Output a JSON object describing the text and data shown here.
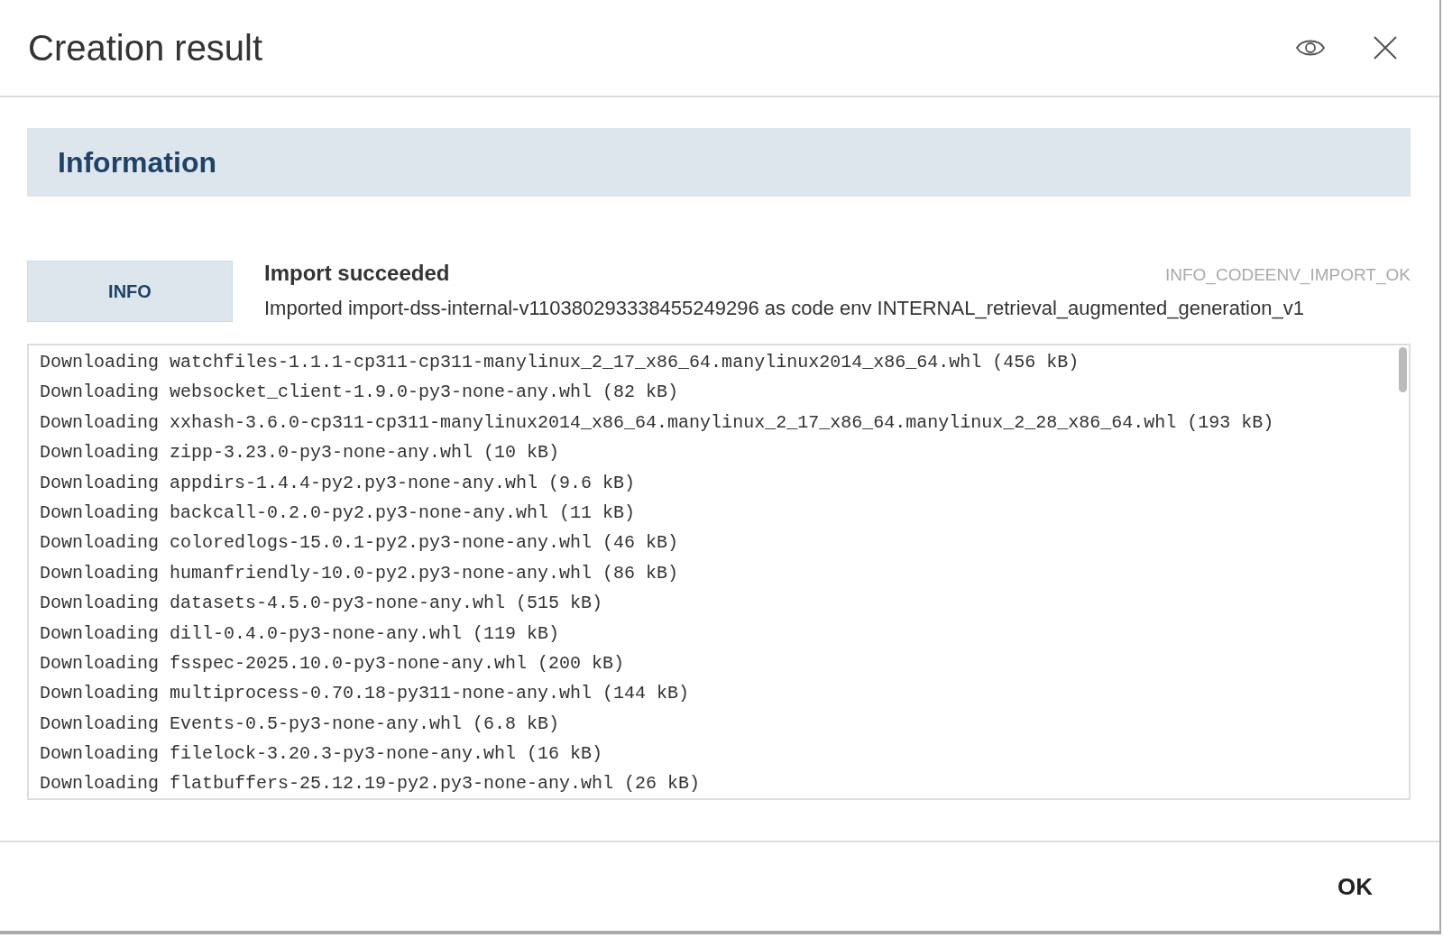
{
  "dialog": {
    "title": "Creation result"
  },
  "section": {
    "title": "Information"
  },
  "message": {
    "level": "INFO",
    "title": "Import succeeded",
    "code": "INFO_CODEENV_IMPORT_OK",
    "text": "Imported import-dss-internal-v110380293338455249296 as code env INTERNAL_retrieval_augmented_generation_v1"
  },
  "log_lines": [
    "Downloading watchfiles-1.1.1-cp311-cp311-manylinux_2_17_x86_64.manylinux2014_x86_64.whl (456 kB)",
    "Downloading websocket_client-1.9.0-py3-none-any.whl (82 kB)",
    "Downloading xxhash-3.6.0-cp311-cp311-manylinux2014_x86_64.manylinux_2_17_x86_64.manylinux_2_28_x86_64.whl (193 kB)",
    "Downloading zipp-3.23.0-py3-none-any.whl (10 kB)",
    "Downloading appdirs-1.4.4-py2.py3-none-any.whl (9.6 kB)",
    "Downloading backcall-0.2.0-py2.py3-none-any.whl (11 kB)",
    "Downloading coloredlogs-15.0.1-py2.py3-none-any.whl (46 kB)",
    "Downloading humanfriendly-10.0-py2.py3-none-any.whl (86 kB)",
    "Downloading datasets-4.5.0-py3-none-any.whl (515 kB)",
    "Downloading dill-0.4.0-py3-none-any.whl (119 kB)",
    "Downloading fsspec-2025.10.0-py3-none-any.whl (200 kB)",
    "Downloading multiprocess-0.70.18-py311-none-any.whl (144 kB)",
    "Downloading Events-0.5-py3-none-any.whl (6.8 kB)",
    "Downloading filelock-3.20.3-py3-none-any.whl (16 kB)",
    "Downloading flatbuffers-25.12.19-py2.py3-none-any.whl (26 kB)"
  ],
  "buttons": [
    "OK"
  ]
}
